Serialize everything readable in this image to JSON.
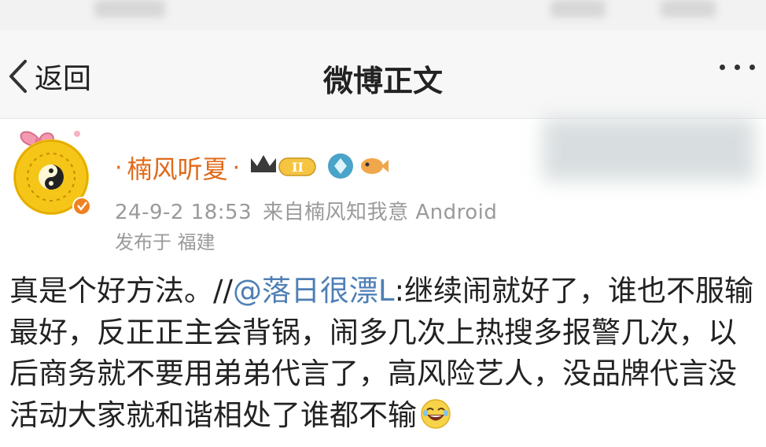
{
  "nav": {
    "back_label": "返回",
    "title": "微博正文",
    "back_icon": "chevron-left-icon",
    "more_icon": "more-dots-icon"
  },
  "post": {
    "author": "楠风听夏",
    "separator": "·",
    "badges": [
      "crown-level-icon",
      "diamond-icon",
      "fish-icon"
    ],
    "level_label": "II",
    "timestamp": "24-9-2 18:53",
    "source": "来自楠风知我意 Android",
    "location": "发布于 福建",
    "content_prefix": "真是个好方法。//",
    "mention": "@落日很漂L",
    "content_rest": ":继续闹就好了，谁也不服输最好，反正正主会背锅，闹多几次上热搜多报警几次，以后商务就不要用弟弟代言了，高风险艺人，没品牌代言没活动大家就和谐相处了谁都不输",
    "emoji": "laughing-emoji-icon"
  },
  "colors": {
    "username": "#e06a1a",
    "mention": "#4f7fb5",
    "meta": "#9a9a9a",
    "avatar_bg": "#f5c518",
    "verified": "#f08020"
  }
}
